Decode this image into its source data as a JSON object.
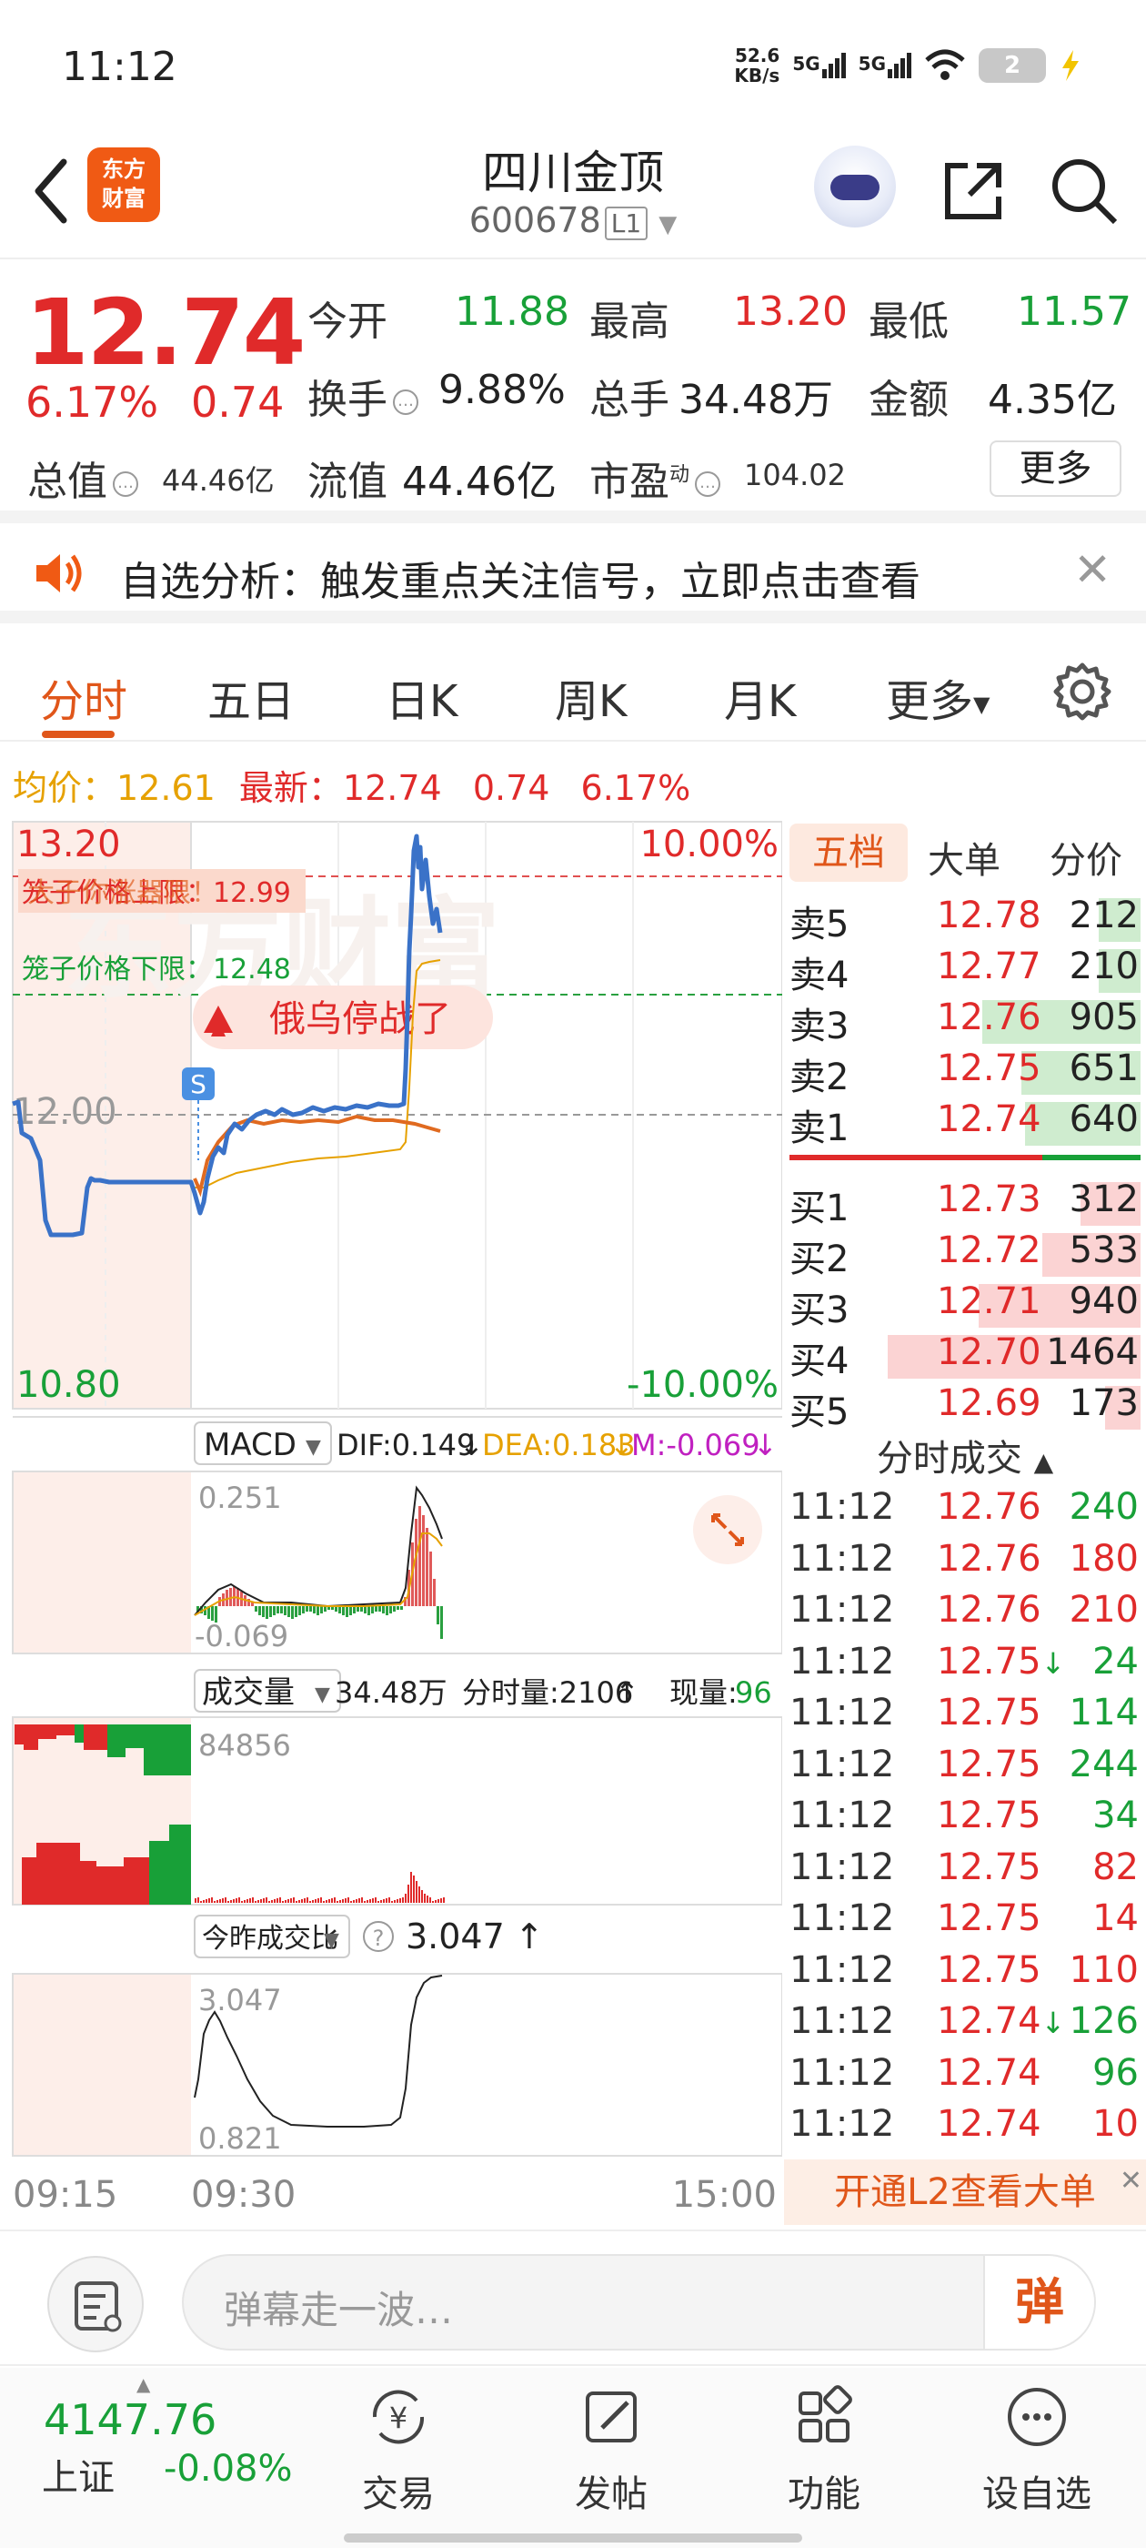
{
  "status": {
    "time": "11:12",
    "net_speed": "52.6",
    "net_unit": "KB/s",
    "sig1": "5G",
    "sig2": "5G",
    "battery": "2"
  },
  "nav": {
    "logo_line1": "东方",
    "logo_line2": "财富",
    "title": "四川金顶",
    "code": "600678",
    "level": "L1"
  },
  "quote": {
    "price": "12.74",
    "pct": "6.17%",
    "change": "0.74",
    "open_label": "今开",
    "open": "11.88",
    "high_label": "最高",
    "high": "13.20",
    "low_label": "最低",
    "low": "11.57",
    "turnover_label": "换手",
    "turnover": "9.88%",
    "vol_label": "总手",
    "vol": "34.48万",
    "amount_label": "金额",
    "amount": "4.35亿",
    "mktcap_label": "总值",
    "mktcap": "44.46亿",
    "float_label": "流值",
    "float": "44.46亿",
    "pe_label": "市盈",
    "pe_sup": "动",
    "pe": "104.02",
    "more": "更多"
  },
  "notice": {
    "text": "自选分析：触发重点关注信号，立即点击查看"
  },
  "tabs": {
    "t1": "分时",
    "t2": "五日",
    "t3": "日K",
    "t4": "周K",
    "t5": "月K",
    "t6": "更多"
  },
  "avg": {
    "label": "均价：",
    "value": "12.61",
    "latest_label": "最新：",
    "latest": "12.74",
    "chg": "0.74",
    "pct": "6.17%"
  },
  "chart": {
    "y_top": "13.20",
    "y_mid": "12.00",
    "y_bottom": "10.80",
    "pct_top": "10.00%",
    "pct_bottom": "-10.00%",
    "upper_limit_text": "笼子价格上限：12.99",
    "overlay_text": "大于你涨器限！",
    "lower_limit_text": "笼子价格下限：12.48",
    "news_badge": "俄乌停战了",
    "s_marker": "S",
    "watermark": "东方财富",
    "macd_label": "MACD",
    "dif": "DIF:0.149",
    "dea": "DEA:0.183",
    "m": "M:-0.069",
    "macd_top": "0.251",
    "macd_bottom": "-0.069",
    "vol_label": "成交量",
    "vol_total": "34.48万",
    "vol_fen": "分时量:2106",
    "vol_now_label": "现量:",
    "vol_now": "96",
    "vol_max": "84856",
    "ratio_label": "今昨成交比",
    "ratio_val": "3.047",
    "ratio_top": "3.047",
    "ratio_bottom": "0.821",
    "t_start": "09:15",
    "t_open": "09:30",
    "t_end": "15:00"
  },
  "orderbook": {
    "tabs": [
      "五档",
      "大单",
      "分价"
    ],
    "sells": [
      {
        "label": "卖5",
        "price": "12.78",
        "vol": "212",
        "bar": 0.12
      },
      {
        "label": "卖4",
        "price": "12.77",
        "vol": "210",
        "bar": 0.12
      },
      {
        "label": "卖3",
        "price": "12.76",
        "vol": "905",
        "bar": 0.45
      },
      {
        "label": "卖2",
        "price": "12.75",
        "vol": "651",
        "bar": 0.34
      },
      {
        "label": "卖1",
        "price": "12.74",
        "vol": "640",
        "bar": 0.33
      }
    ],
    "buys": [
      {
        "label": "买1",
        "price": "12.73",
        "vol": "312",
        "bar": 0.17
      },
      {
        "label": "买2",
        "price": "12.72",
        "vol": "533",
        "bar": 0.28
      },
      {
        "label": "买3",
        "price": "12.71",
        "vol": "940",
        "bar": 0.46
      },
      {
        "label": "买4",
        "price": "12.70",
        "vol": "1464",
        "bar": 0.72
      },
      {
        "label": "买5",
        "price": "12.69",
        "vol": "173",
        "bar": 0.1
      }
    ],
    "trades_title": "分时成交",
    "trades": [
      {
        "t": "11:12",
        "p": "12.76",
        "v": "240",
        "c": "green"
      },
      {
        "t": "11:12",
        "p": "12.76",
        "v": "180",
        "c": "red"
      },
      {
        "t": "11:12",
        "p": "12.76",
        "v": "210",
        "c": "red"
      },
      {
        "t": "11:12",
        "p": "12.75↓",
        "v": "24",
        "c": "green"
      },
      {
        "t": "11:12",
        "p": "12.75",
        "v": "114",
        "c": "green"
      },
      {
        "t": "11:12",
        "p": "12.75",
        "v": "244",
        "c": "green"
      },
      {
        "t": "11:12",
        "p": "12.75",
        "v": "34",
        "c": "green"
      },
      {
        "t": "11:12",
        "p": "12.75",
        "v": "82",
        "c": "red"
      },
      {
        "t": "11:12",
        "p": "12.75",
        "v": "14",
        "c": "red"
      },
      {
        "t": "11:12",
        "p": "12.75",
        "v": "110",
        "c": "red"
      },
      {
        "t": "11:12",
        "p": "12.74↓",
        "v": "126",
        "c": "green"
      },
      {
        "t": "11:12",
        "p": "12.74",
        "v": "96",
        "c": "green"
      },
      {
        "t": "11:12",
        "p": "12.74",
        "v": "10",
        "c": "red"
      }
    ],
    "l2_text": "开通L2查看大单"
  },
  "comment": {
    "placeholder": "弹幕走一波…",
    "dan": "弹"
  },
  "bottom": {
    "index_value": "4147.76",
    "index_name": "上证",
    "index_change": "-0.08%",
    "b1": "交易",
    "b2": "发帖",
    "b3": "功能",
    "b4": "设自选"
  },
  "colors": {
    "red": "#e02a2a",
    "green": "#18a038",
    "accent": "#e0561a",
    "avg_line": "#e6a100",
    "price_line": "#3a72c8"
  }
}
